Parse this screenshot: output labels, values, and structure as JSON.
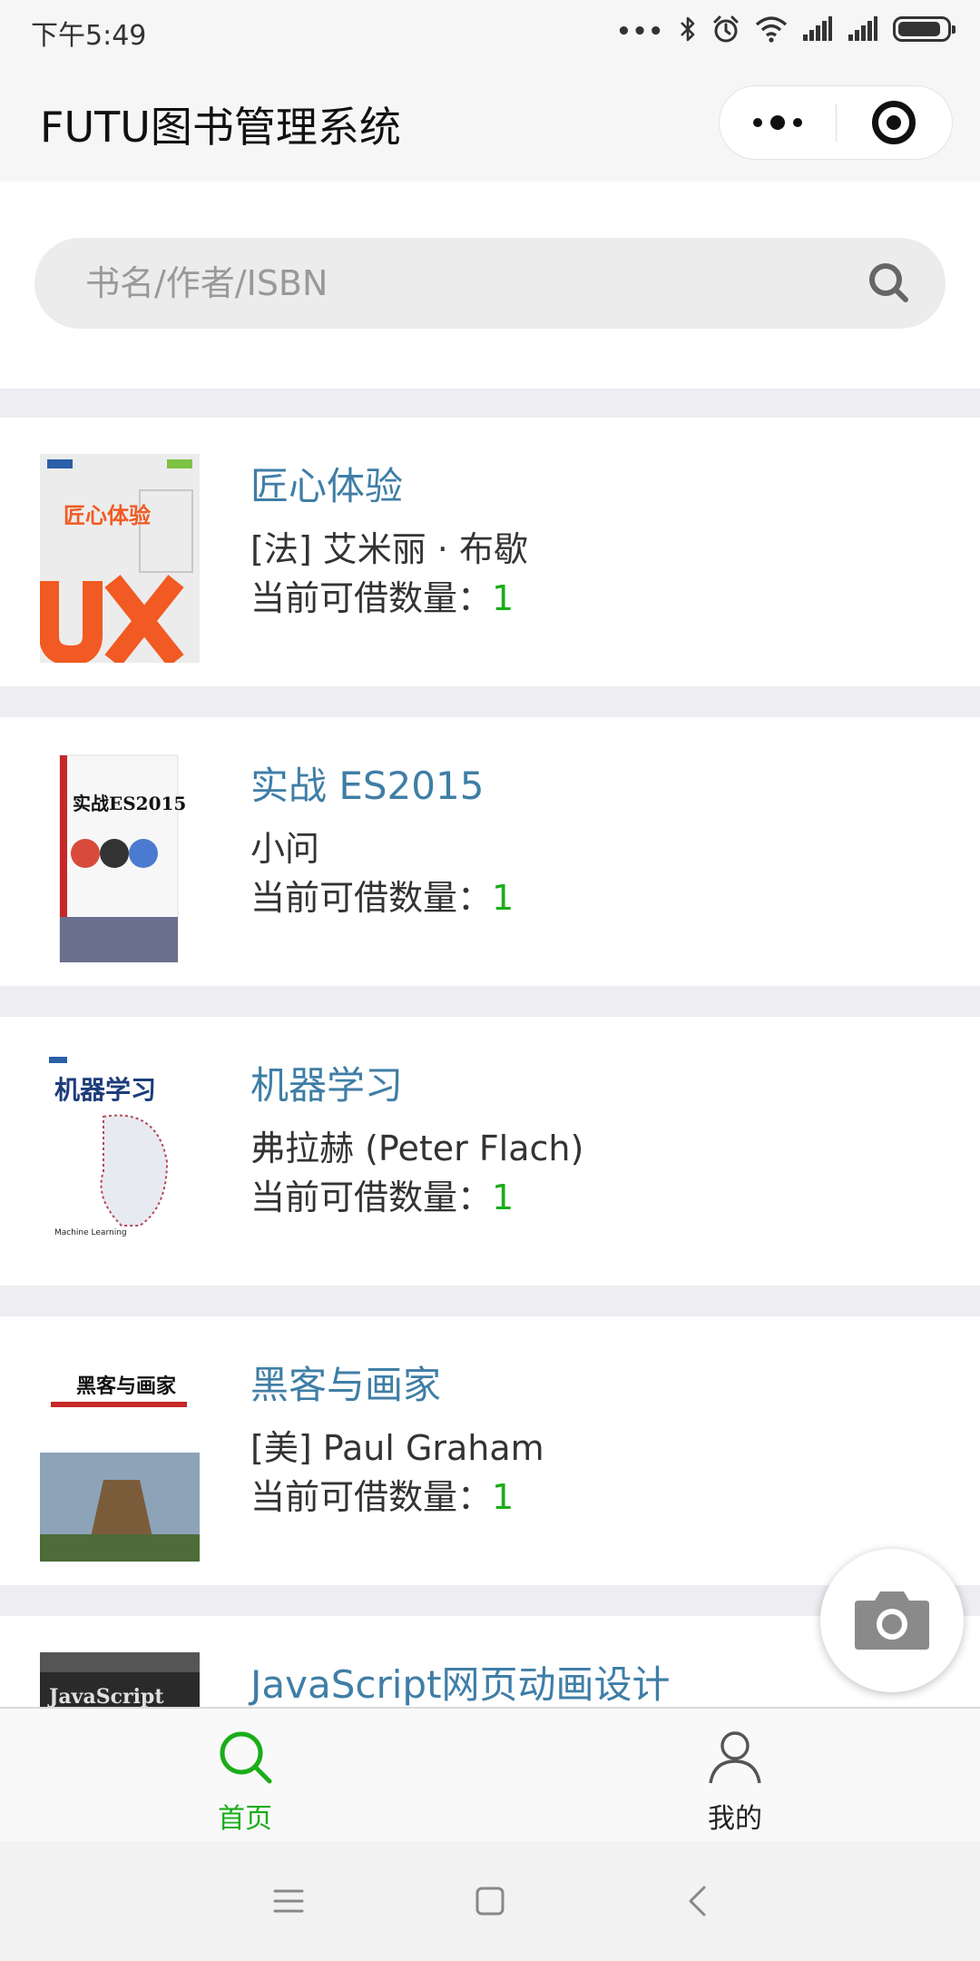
{
  "status_bar": {
    "time": "下午5:49",
    "icons": [
      "more-dots-icon",
      "bluetooth-icon",
      "alarm-icon",
      "wifi-icon",
      "signal-icon",
      "signal-icon",
      "battery-icon"
    ]
  },
  "nav_bar": {
    "title": "FUTU图书管理系统",
    "capsule": [
      "more-icon",
      "close-target-icon"
    ]
  },
  "search": {
    "placeholder": "书名/作者/ISBN",
    "value": "",
    "icon": "search-icon"
  },
  "books": [
    {
      "title": "匠心体验",
      "author": "[法] 艾米丽 · 布歇",
      "count_label": "当前可借数量：",
      "count": "1",
      "cover_text": "匠心体验",
      "cover_accent": "#f15a22"
    },
    {
      "title": "实战 ES2015",
      "author": "小问",
      "count_label": "当前可借数量：",
      "count": "1",
      "cover_text": "实战ES2015",
      "cover_accent": "#6b6f8e"
    },
    {
      "title": "机器学习",
      "author": "弗拉赫 (Peter Flach)",
      "count_label": "当前可借数量：",
      "count": "1",
      "cover_text": "机器学习",
      "cover_accent": "#1d3d7a"
    },
    {
      "title": "黑客与画家",
      "author": "[美] Paul Graham",
      "count_label": "当前可借数量：",
      "count": "1",
      "cover_text": "黑客与画家",
      "cover_accent": "#7a5c3a"
    },
    {
      "title": "JavaScript网页动画设计",
      "author": "",
      "count_label": "",
      "count": "",
      "cover_text": "JavaScript",
      "cover_accent": "#222222"
    }
  ],
  "fab": {
    "icon": "camera-icon"
  },
  "tab_bar": {
    "tabs": [
      {
        "label": "首页",
        "icon": "search-icon",
        "active": true
      },
      {
        "label": "我的",
        "icon": "user-icon",
        "active": false
      }
    ]
  },
  "system_nav": {
    "icons": [
      "menu-icon",
      "home-square-icon",
      "back-icon"
    ]
  },
  "colors": {
    "accent": "#1aad19",
    "title_link": "#3f7ea6",
    "background": "#ededf2"
  }
}
